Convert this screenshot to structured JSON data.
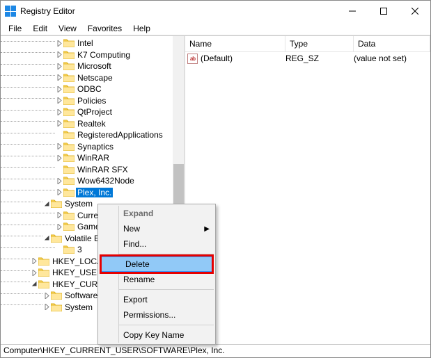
{
  "window": {
    "title": "Registry Editor"
  },
  "menu": {
    "file": "File",
    "edit": "Edit",
    "view": "View",
    "favorites": "Favorites",
    "help": "Help"
  },
  "tree": {
    "items": [
      {
        "label": "Intel",
        "depth": 4,
        "expander": "closed"
      },
      {
        "label": "K7 Computing",
        "depth": 4,
        "expander": "closed"
      },
      {
        "label": "Microsoft",
        "depth": 4,
        "expander": "closed"
      },
      {
        "label": "Netscape",
        "depth": 4,
        "expander": "closed"
      },
      {
        "label": "ODBC",
        "depth": 4,
        "expander": "closed"
      },
      {
        "label": "Policies",
        "depth": 4,
        "expander": "closed"
      },
      {
        "label": "QtProject",
        "depth": 4,
        "expander": "closed"
      },
      {
        "label": "Realtek",
        "depth": 4,
        "expander": "closed"
      },
      {
        "label": "RegisteredApplications",
        "depth": 4,
        "expander": "none"
      },
      {
        "label": "Synaptics",
        "depth": 4,
        "expander": "closed"
      },
      {
        "label": "WinRAR",
        "depth": 4,
        "expander": "closed"
      },
      {
        "label": "WinRAR SFX",
        "depth": 4,
        "expander": "none"
      },
      {
        "label": "Wow6432Node",
        "depth": 4,
        "expander": "closed"
      },
      {
        "label": "Plex, Inc.",
        "depth": 4,
        "expander": "closed",
        "selected": true
      },
      {
        "label": "System",
        "depth": 3,
        "expander": "open"
      },
      {
        "label": "CurrentControlSet",
        "depth": 4,
        "expander": "closed",
        "truncate": "Curren"
      },
      {
        "label": "GameConfigStore",
        "depth": 4,
        "expander": "closed",
        "truncate": "Game"
      },
      {
        "label": "Volatile Environment",
        "depth": 3,
        "expander": "open",
        "truncate": "Volatile En"
      },
      {
        "label": "3",
        "depth": 4,
        "expander": "none"
      },
      {
        "label": "HKEY_LOCAL_MACHINE",
        "depth": 2,
        "expander": "closed",
        "truncate": "HKEY_LOCAL"
      },
      {
        "label": "HKEY_USERS",
        "depth": 2,
        "expander": "closed",
        "truncate": "HKEY_USERS"
      },
      {
        "label": "HKEY_CURRENT_CONFIG",
        "depth": 2,
        "expander": "open",
        "truncate": "HKEY_CURRE"
      },
      {
        "label": "Software",
        "depth": 3,
        "expander": "closed"
      },
      {
        "label": "System",
        "depth": 3,
        "expander": "closed"
      }
    ]
  },
  "list": {
    "header": {
      "name": "Name",
      "type": "Type",
      "data": "Data"
    },
    "rows": [
      {
        "name": "(Default)",
        "type": "REG_SZ",
        "data": "(value not set)",
        "icon": "ab"
      }
    ]
  },
  "status": "Computer\\HKEY_CURRENT_USER\\SOFTWARE\\Plex, Inc.",
  "context_menu": {
    "expand": "Expand",
    "new": "New",
    "find": "Find...",
    "delete": "Delete",
    "rename": "Rename",
    "export": "Export",
    "permissions": "Permissions...",
    "copy_key": "Copy Key Name"
  }
}
